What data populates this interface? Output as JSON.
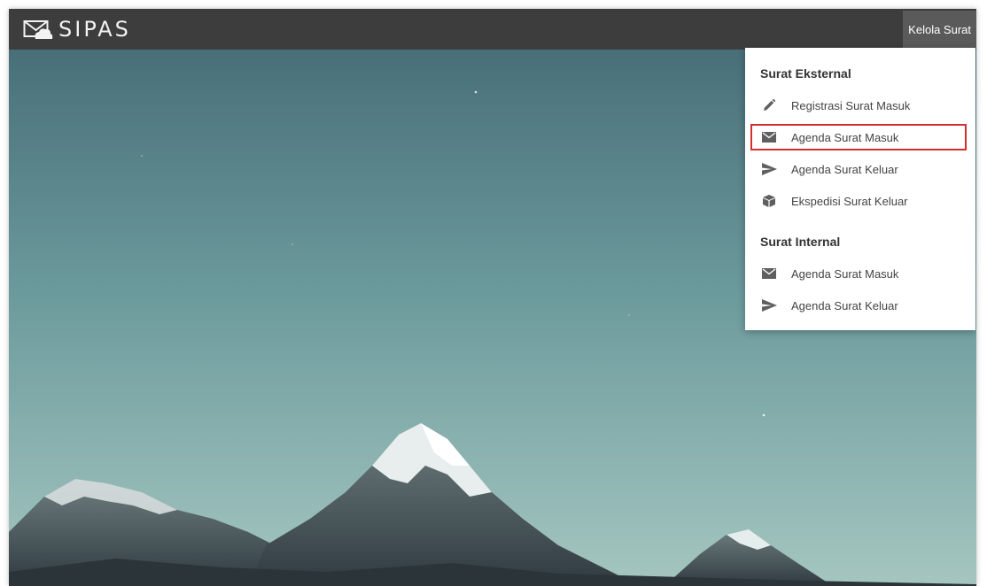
{
  "app": {
    "title": "SIPAS",
    "logo_icon": "envelope-cloud-icon"
  },
  "header": {
    "menu_button_label": "Kelola Surat"
  },
  "dropdown": {
    "sections": [
      {
        "title": "Surat Eksternal",
        "items": [
          {
            "label": "Registrasi Surat Masuk",
            "icon": "pencil-icon"
          },
          {
            "label": "Agenda Surat Masuk",
            "icon": "envelope-icon",
            "highlighted": true
          },
          {
            "label": "Agenda Surat Keluar",
            "icon": "send-icon"
          },
          {
            "label": "Ekspedisi Surat Keluar",
            "icon": "box-icon"
          }
        ]
      },
      {
        "title": "Surat Internal",
        "items": [
          {
            "label": "Agenda Surat Masuk",
            "icon": "envelope-icon"
          },
          {
            "label": "Agenda Surat Keluar",
            "icon": "send-icon"
          }
        ]
      }
    ]
  },
  "colors": {
    "topbar": "#3d3d3d",
    "menu_button": "#5a5a5a",
    "highlight_border": "#d32f2f",
    "icon": "#5f5f5f"
  }
}
